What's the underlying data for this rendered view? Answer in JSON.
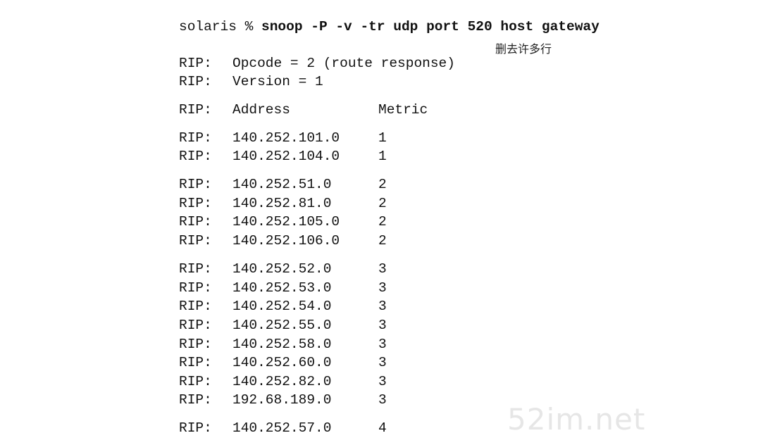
{
  "command": {
    "prompt": "solaris % ",
    "text": "snoop -P -v -tr udp port 520 host gateway"
  },
  "annotation": "删去许多行",
  "header_lines": [
    {
      "tag": "RIP:",
      "text": "Opcode = 2 (route response)"
    },
    {
      "tag": "RIP:",
      "text": "Version = 1"
    }
  ],
  "table": {
    "tag": "RIP:",
    "col_address": "Address",
    "col_metric": "Metric"
  },
  "rows": [
    {
      "tag": "RIP:",
      "address": "140.252.101.0",
      "metric": "1"
    },
    {
      "tag": "RIP:",
      "address": "140.252.104.0",
      "metric": "1"
    },
    {
      "tag": "RIP:",
      "address": "140.252.51.0",
      "metric": "2"
    },
    {
      "tag": "RIP:",
      "address": "140.252.81.0",
      "metric": "2"
    },
    {
      "tag": "RIP:",
      "address": "140.252.105.0",
      "metric": "2"
    },
    {
      "tag": "RIP:",
      "address": "140.252.106.0",
      "metric": "2"
    },
    {
      "tag": "RIP:",
      "address": "140.252.52.0",
      "metric": "3"
    },
    {
      "tag": "RIP:",
      "address": "140.252.53.0",
      "metric": "3"
    },
    {
      "tag": "RIP:",
      "address": "140.252.54.0",
      "metric": "3"
    },
    {
      "tag": "RIP:",
      "address": "140.252.55.0",
      "metric": "3"
    },
    {
      "tag": "RIP:",
      "address": "140.252.58.0",
      "metric": "3"
    },
    {
      "tag": "RIP:",
      "address": "140.252.60.0",
      "metric": "3"
    },
    {
      "tag": "RIP:",
      "address": "140.252.82.0",
      "metric": "3"
    },
    {
      "tag": "RIP:",
      "address": "192.68.189.0",
      "metric": "3"
    },
    {
      "tag": "RIP:",
      "address": "140.252.57.0",
      "metric": "4"
    }
  ],
  "watermark": "52im.net"
}
